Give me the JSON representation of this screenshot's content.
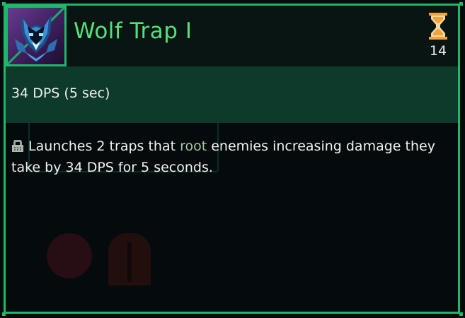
{
  "tooltip": {
    "title": "Wolf Trap I",
    "cooldown": {
      "icon": "hourglass-icon",
      "value": "14"
    },
    "icon": "wolf-trap-icon",
    "stat_line": "34 DPS (5 sec)",
    "description": {
      "lock_icon": "lock-icon",
      "part1": "Launches 2 traps that ",
      "keyword": "root",
      "part2": " enemies increasing damage they take by 34 DPS for 5 seconds."
    }
  },
  "colors": {
    "frame": "#1fb86b",
    "title": "#56e07a",
    "stat_band": "#0d3a2a",
    "keyword": "#a9c4a2",
    "icon_background": "#5a2f82"
  }
}
